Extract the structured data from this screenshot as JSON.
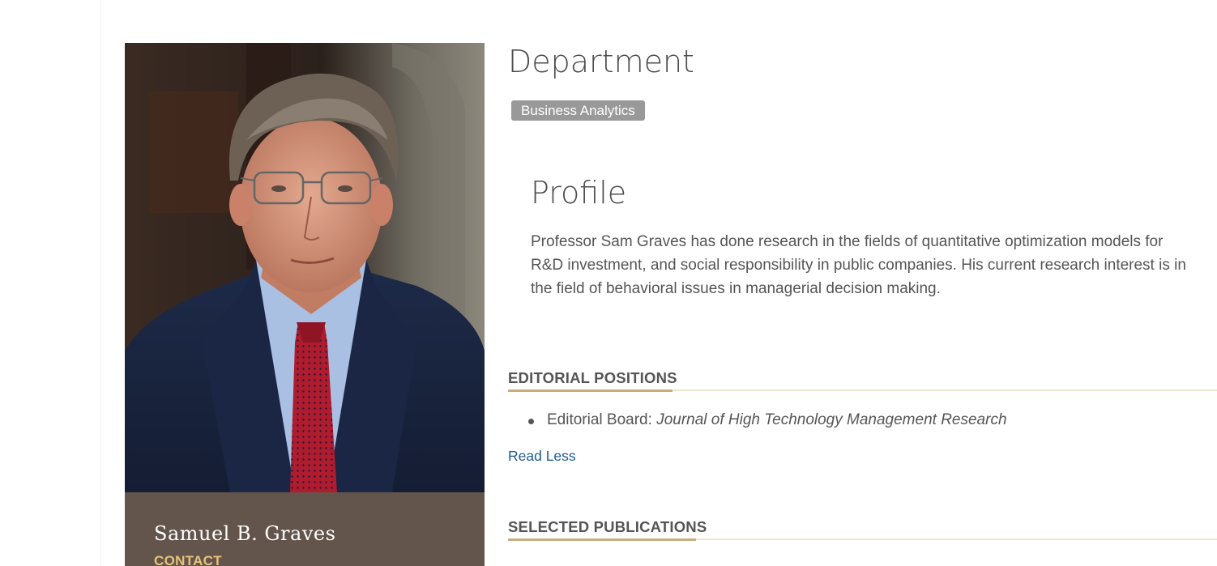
{
  "person": {
    "name": "Samuel B. Graves",
    "contact_label": "CONTACT",
    "photo_alt": "Samuel B. Graves"
  },
  "department": {
    "heading": "Department",
    "tags": [
      "Business Analytics"
    ]
  },
  "profile": {
    "heading": "Profile",
    "lines": [
      "Professor Sam Graves has done research in the fields of quantitative optimization models for",
      "R&D investment, and social responsibility in public companies. His current research interest is in",
      "the field of behavioral issues in managerial decision making."
    ]
  },
  "editorial_positions": {
    "heading": "EDITORIAL POSITIONS",
    "items": [
      {
        "prefix": "Editorial Board: ",
        "journal": "Journal of High Technology Management Research"
      }
    ],
    "toggle_label": "Read Less"
  },
  "selected_publications": {
    "heading": "SELECTED PUBLICATIONS"
  },
  "colors": {
    "name_plate": "#64554c",
    "contact": "#e7c27a",
    "tag_bg": "#999999",
    "link": "#1f5a91",
    "rule": "#efe6cf",
    "rule_accent": "#c8ad7f"
  }
}
